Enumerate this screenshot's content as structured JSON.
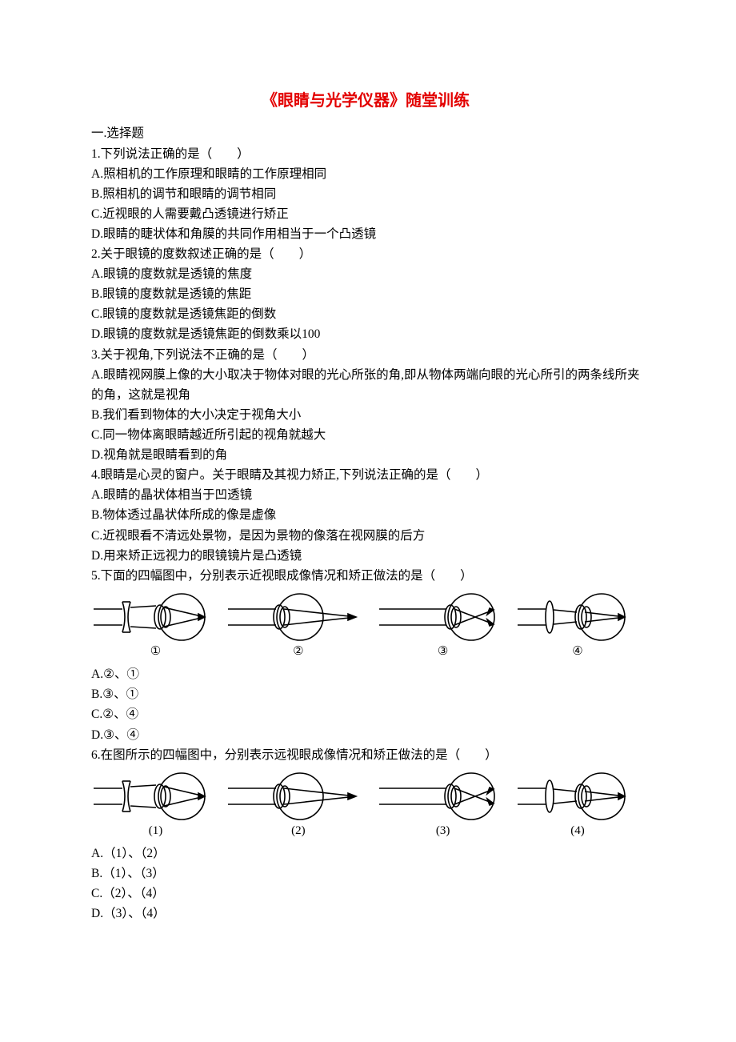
{
  "title": "《眼睛与光学仪器》随堂训练",
  "section1": "一.选择题",
  "q1": {
    "stem": "1.下列说法正确的是（　　）",
    "a": "A.照相机的工作原理和眼睛的工作原理相同",
    "b": "B.照相机的调节和眼睛的调节相同",
    "c": "C.近视眼的人需要戴凸透镜进行矫正",
    "d": "D.眼睛的睫状体和角膜的共同作用相当于一个凸透镜"
  },
  "q2": {
    "stem": "2.关于眼镜的度数叙述正确的是（　　）",
    "a": "A.眼镜的度数就是透镜的焦度",
    "b": "B.眼镜的度数就是透镜的焦距",
    "c": "C.眼镜的度数就是透镜焦距的倒数",
    "d": "D.眼镜的度数就是透镜焦距的倒数乘以100"
  },
  "q3": {
    "stem": "3.关于视角,下列说法不正确的是（　　）",
    "a": "A.眼睛视网膜上像的大小取决于物体对眼的光心所张的角,即从物体两端向眼的光心所引的两条线所夹的角，这就是视角",
    "b": "B.我们看到物体的大小决定于视角大小",
    "c": "C.同一物体离眼睛越近所引起的视角就越大",
    "d": "D.视角就是眼睛看到的角"
  },
  "q4": {
    "stem": "4.眼睛是心灵的窗户。关于眼睛及其视力矫正,下列说法正确的是（　　）",
    "a": "A.眼睛的晶状体相当于凹透镜",
    "b": "B.物体透过晶状体所成的像是虚像",
    "c": "C.近视眼看不清远处景物，是因为景物的像落在视网膜的后方",
    "d": "D.用来矫正远视力的眼镜镜片是凸透镜"
  },
  "q5": {
    "stem": "5.下面的四幅图中，分别表示近视眼成像情况和矫正做法的是（　　）",
    "labels": {
      "l1": "①",
      "l2": "②",
      "l3": "③",
      "l4": "④"
    },
    "a": "A.②、①",
    "b": "B.③、①",
    "c": "C.②、④",
    "d": "D.③、④"
  },
  "q6": {
    "stem": "6.在图所示的四幅图中，分别表示远视眼成像情况和矫正做法的是（　　）",
    "labels": {
      "l1": "(1)",
      "l2": "(2)",
      "l3": "(3)",
      "l4": "(4)"
    },
    "a": "A.（1）、（2）",
    "b": "B.（1）、（3）",
    "c": "C.（2）、（4）",
    "d": "D.（3）、（4）"
  }
}
